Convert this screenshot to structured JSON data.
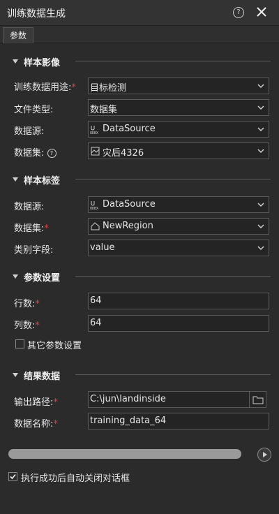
{
  "window": {
    "title": "训练数据生成",
    "help_glyph": "?"
  },
  "tabs": [
    {
      "label": "参数"
    }
  ],
  "sections": {
    "sample_image": {
      "title": "样本影像",
      "usage_label": "训练数据用途:",
      "usage_value": "目标检测",
      "filetype_label": "文件类型:",
      "filetype_value": "数据集",
      "datasource_label": "数据源:",
      "datasource_value": "DataSource",
      "dataset_label": "数据集:",
      "dataset_value": "灾后4326"
    },
    "sample_label": {
      "title": "样本标签",
      "datasource_label": "数据源:",
      "datasource_value": "DataSource",
      "dataset_label": "数据集:",
      "dataset_value": "NewRegion",
      "class_field_label": "类别字段:",
      "class_field_value": "value"
    },
    "params": {
      "title": "参数设置",
      "rows_label": "行数:",
      "rows_value": "64",
      "cols_label": "列数:",
      "cols_value": "64",
      "other_params_label": "其它参数设置"
    },
    "result": {
      "title": "结果数据",
      "output_path_label": "输出路径:",
      "output_path_value": "C:\\jun\\landinside",
      "data_name_label": "数据名称:",
      "data_name_value": "training_data_64"
    }
  },
  "footer": {
    "auto_close_label": "执行成功后自动关闭对话框",
    "auto_close_checked": true
  },
  "icons": {
    "udb": "udb-icon",
    "raster": "raster-dataset-icon",
    "region": "region-dataset-icon",
    "folder": "folder-icon",
    "run": "play-icon",
    "help": "help-icon",
    "close": "close-icon"
  },
  "colors": {
    "required": "#e04040",
    "background": "#2b2b2b"
  }
}
